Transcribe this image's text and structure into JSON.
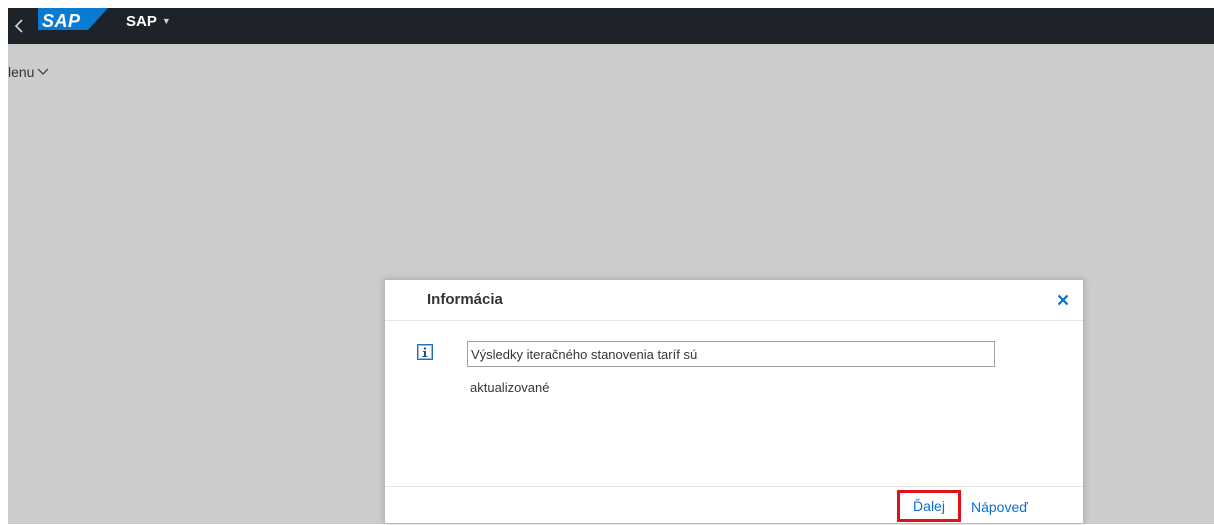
{
  "shell": {
    "logo_text": "SAP",
    "app_title": "SAP"
  },
  "menu": {
    "label": "lenu"
  },
  "dialog": {
    "title": "Informácia",
    "message_line1": "Výsledky iteračného stanovenia taríf sú",
    "message_line2": "aktualizované",
    "buttons": {
      "continue": "Ďalej",
      "help": "Nápoveď"
    }
  },
  "icons": {
    "back": "chevron-left-icon",
    "app_title_caret": "caret-down-icon",
    "menu_chevron": "chevron-down-icon",
    "close": "close-icon",
    "info": "info-icon"
  },
  "colors": {
    "shell_background": "#1e2329",
    "content_background": "#cccccc",
    "link": "#0a6ed1",
    "highlight": "#e3101a",
    "logo_blue": "#0a7bd2"
  }
}
